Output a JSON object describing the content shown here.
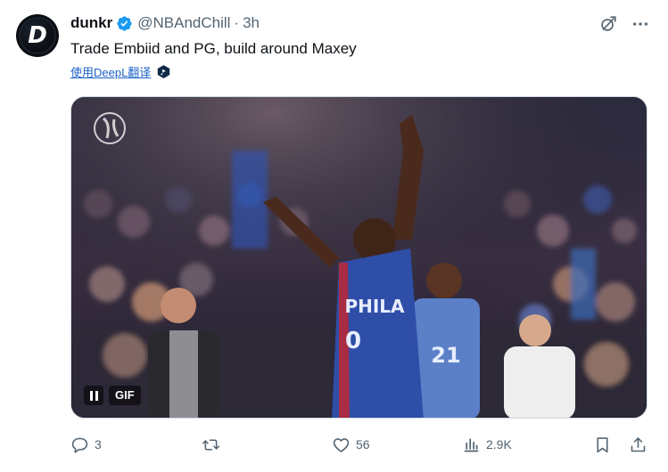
{
  "tweet": {
    "author_name": "dunkr",
    "author_avatar_letter": "D",
    "handle": "@NBAndChill",
    "separator": "·",
    "time": "3h",
    "text": "Trade Embiid and PG, build around Maxey",
    "translate_label": "使用DeepL翻译",
    "verified_color": "#1d9bf0"
  },
  "media": {
    "type": "GIF",
    "gif_label": "GIF",
    "pause_icon": "pause-icon",
    "jersey_number": "0",
    "jersey_text": "PHILA",
    "second_jersey_number": "21"
  },
  "actions": {
    "replies": "3",
    "retweets": "",
    "likes": "56",
    "views": "2.9K"
  },
  "icons": [
    "grok-icon",
    "more-icon",
    "reply-icon",
    "retweet-icon",
    "like-icon",
    "views-icon",
    "bookmark-icon",
    "share-icon"
  ]
}
